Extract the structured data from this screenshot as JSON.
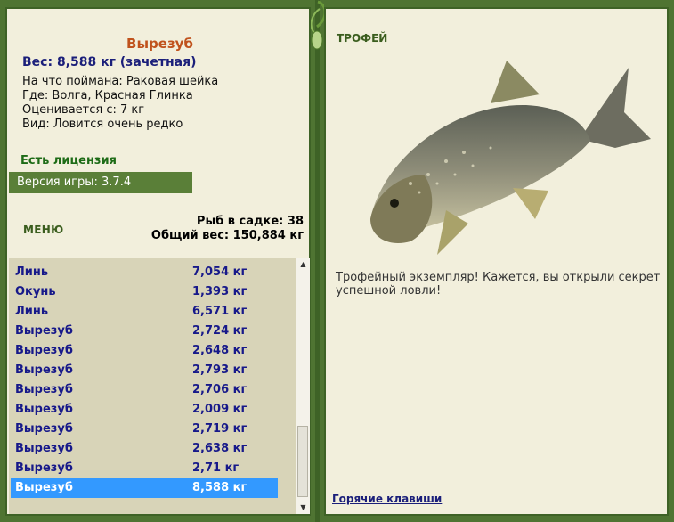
{
  "fish_info": {
    "name": "Вырезуб",
    "weight_line": "Вес: 8,588 кг (зачетная)",
    "caught_on": "На что поймана: Раковая шейка",
    "location": "Где: Волга, Красная Глинка",
    "rated_from": "Оценивается с: 7 кг",
    "rarity": "Вид: Ловится очень редко"
  },
  "license": "Есть лицензия",
  "version": "Версия игры: 3.7.4",
  "menu_label": "МЕНЮ",
  "catch_summary": {
    "fish_count": "Рыб в садке: 38",
    "total_weight": "Общий вес: 150,884 кг"
  },
  "catch_list": [
    {
      "name": "Линь",
      "weight": "7,054 кг"
    },
    {
      "name": "Окунь",
      "weight": "1,393 кг"
    },
    {
      "name": "Линь",
      "weight": "6,571 кг"
    },
    {
      "name": "Вырезуб",
      "weight": "2,724 кг"
    },
    {
      "name": "Вырезуб",
      "weight": "2,648 кг"
    },
    {
      "name": "Вырезуб",
      "weight": "2,793 кг"
    },
    {
      "name": "Вырезуб",
      "weight": "2,706 кг"
    },
    {
      "name": "Вырезуб",
      "weight": "2,009 кг"
    },
    {
      "name": "Вырезуб",
      "weight": "2,719 кг"
    },
    {
      "name": "Вырезуб",
      "weight": "2,638 кг"
    },
    {
      "name": "Вырезуб",
      "weight": "2,71 кг"
    },
    {
      "name": "Вырезуб",
      "weight": "8,588 кг"
    }
  ],
  "selected_index": 11,
  "trophy": {
    "label": "ТРОФЕЙ",
    "message": "Трофейный экземпляр! Кажется, вы открыли секрет успешной ловли!"
  },
  "hotkeys_link": "Горячие клавиши",
  "colors": {
    "frame_green": "#4f7432",
    "panel_bg": "#f2efdc",
    "list_bg": "#d8d4b8",
    "selection_blue": "#3399ff",
    "fish_name_orange": "#c0521c",
    "text_navy": "#1b1f7a"
  }
}
